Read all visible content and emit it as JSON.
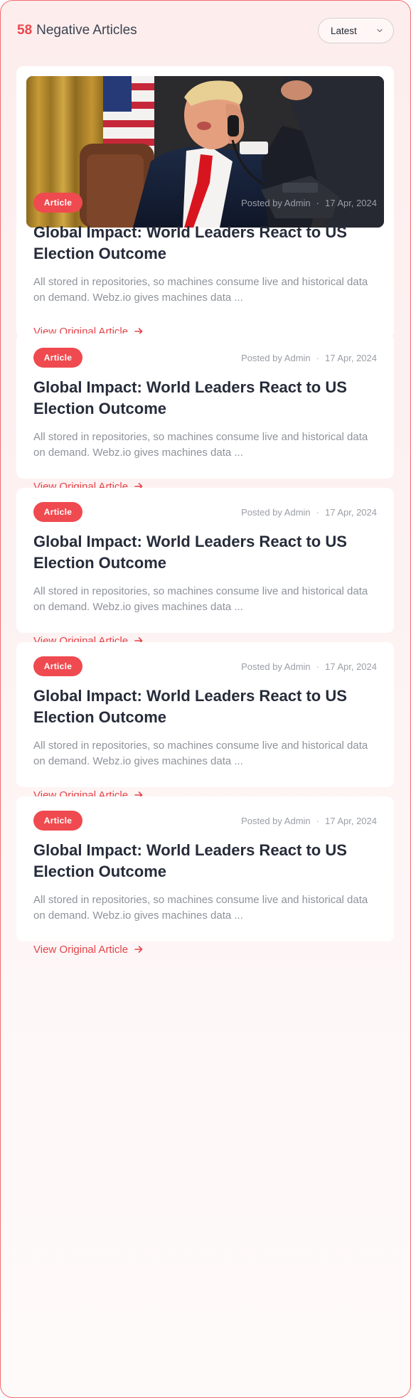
{
  "header": {
    "count": "58",
    "title": "Negative Articles",
    "sort": {
      "selected": "Latest"
    }
  },
  "colors": {
    "accent": "#ef4a4f",
    "title": "#262c3a",
    "muted": "#8e929a"
  },
  "articles": [
    {
      "has_image": true,
      "badge": "Article",
      "posted_by": "Posted by Admin",
      "dot": "·",
      "date": "17 Apr, 2024",
      "title": "Global Impact: World Leaders React to US Election Outcome",
      "excerpt": "All stored in repositories, so machines consume live and historical data on demand. Webz.io gives machines data ...",
      "link": "View Original Article"
    },
    {
      "has_image": false,
      "badge": "Article",
      "posted_by": "Posted by Admin",
      "dot": "·",
      "date": "17 Apr, 2024",
      "title": "Global Impact: World Leaders React to US Election Outcome",
      "excerpt": "All stored in repositories, so machines consume live and historical data on demand. Webz.io gives machines data ...",
      "link": "View Original Article"
    },
    {
      "has_image": false,
      "badge": "Article",
      "posted_by": "Posted by Admin",
      "dot": "·",
      "date": "17 Apr, 2024",
      "title": "Global Impact: World Leaders React to US Election Outcome",
      "excerpt": "All stored in repositories, so machines consume live and historical data on demand. Webz.io gives machines data ...",
      "link": "View Original Article"
    },
    {
      "has_image": false,
      "badge": "Article",
      "posted_by": "Posted by Admin",
      "dot": "·",
      "date": "17 Apr, 2024",
      "title": "Global Impact: World Leaders React to US Election Outcome",
      "excerpt": "All stored in repositories, so machines consume live and historical data on demand. Webz.io gives machines data ...",
      "link": "View Original Article"
    },
    {
      "has_image": false,
      "badge": "Article",
      "posted_by": "Posted by Admin",
      "dot": "·",
      "date": "17 Apr, 2024",
      "title": "Global Impact: World Leaders React to US Election Outcome",
      "excerpt": "All stored in repositories, so machines consume live and historical data on demand. Webz.io gives machines data ...",
      "link": "View Original Article"
    }
  ]
}
